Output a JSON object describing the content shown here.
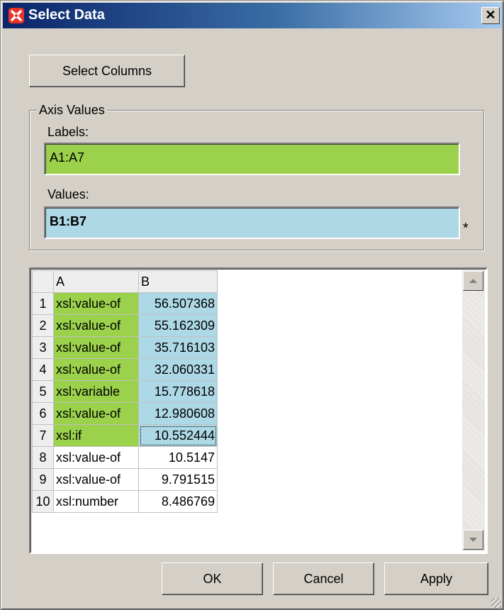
{
  "window": {
    "title": "Select Data",
    "close_label": "✕"
  },
  "buttons": {
    "select_columns": "Select Columns",
    "ok": "OK",
    "cancel": "Cancel",
    "apply": "Apply"
  },
  "axis_values": {
    "legend": "Axis Values",
    "labels_caption": "Labels:",
    "labels_value": "A1:A7",
    "values_caption": "Values:",
    "values_value": "B1:B7",
    "asterisk": "*"
  },
  "grid": {
    "columns": [
      "A",
      "B"
    ],
    "rows": [
      {
        "num": "1",
        "a": "xsl:value-of",
        "b": "56.507368",
        "selected": true
      },
      {
        "num": "2",
        "a": "xsl:value-of",
        "b": "55.162309",
        "selected": true
      },
      {
        "num": "3",
        "a": "xsl:value-of",
        "b": "35.716103",
        "selected": true
      },
      {
        "num": "4",
        "a": "xsl:value-of",
        "b": "32.060331",
        "selected": true
      },
      {
        "num": "5",
        "a": "xsl:variable",
        "b": "15.778618",
        "selected": true
      },
      {
        "num": "6",
        "a": "xsl:value-of",
        "b": "12.980608",
        "selected": true
      },
      {
        "num": "7",
        "a": "xsl:if",
        "b": "10.552444",
        "selected": true
      },
      {
        "num": "8",
        "a": "xsl:value-of",
        "b": "10.5147",
        "selected": false
      },
      {
        "num": "9",
        "a": "xsl:value-of",
        "b": "9.791515",
        "selected": false
      },
      {
        "num": "10",
        "a": "xsl:number",
        "b": "8.486769",
        "selected": false
      }
    ]
  },
  "colors": {
    "labels_highlight": "#9bd14b",
    "values_highlight": "#add8e6",
    "titlebar": "#0a246a"
  }
}
